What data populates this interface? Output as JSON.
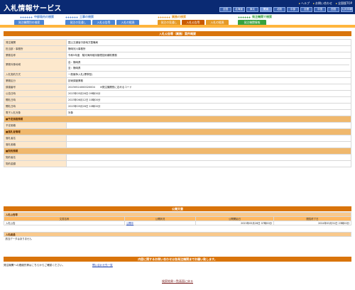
{
  "header": {
    "logo": "入札情報サービス",
    "toplinks": [
      "ヘルプ",
      "お問い合わせ",
      "全国版TOP"
    ],
    "regions": [
      "全国",
      "北海道",
      "東北",
      "関東",
      "北陸",
      "中部",
      "近畿",
      "中国",
      "四国",
      "九州沖縄"
    ],
    "active_region": "関東"
  },
  "nav": {
    "groups": [
      {
        "label": "中部局内の検索",
        "color": "#4d86d4"
      },
      {
        "label": "工事の検索",
        "color": "#4d86d4"
      },
      {
        "label": "業務の検索",
        "color": "#e59a26"
      },
      {
        "label": "発注機関で検索",
        "color": "#37a23f"
      }
    ],
    "tabs": [
      "発注機関別の検索",
      "発注の見通し",
      "入札公告等",
      "入札の経過",
      "発注の見通し",
      "入札公告等",
      "入札の経過",
      "発注機関情報"
    ]
  },
  "detail": {
    "title": "入札公告等（業務）案件概要",
    "rows": [
      {
        "label": "発注機関",
        "value": "国土交通省中部地方整備局"
      },
      {
        "label": "担当部・事務所",
        "value": "静岡河川事務所"
      },
      {
        "label": "業務名称",
        "value": "令和5年度　駿河海岸維持管理技術補助業務"
      },
      {
        "label": "業務対象地域",
        "value": "自：静岡県",
        "value2": "至：静岡県"
      },
      {
        "label": "入札契約方式",
        "value": "一般競争入札(標準型)"
      },
      {
        "label": "業務区分",
        "value": "技術調査業務"
      },
      {
        "label": "調達番号",
        "value": "20230524000020004　　※発注機関別に定めるコード"
      },
      {
        "label": "公告日時",
        "value": "2023年05月26日 09時00分"
      },
      {
        "label": "開札日時",
        "value": "2023年06月12日 10時00分"
      },
      {
        "label": "開札日時",
        "value": "2023年05月26日 10時00分"
      },
      {
        "label": "電子入札対象",
        "value": "対象"
      }
    ],
    "sections": [
      {
        "label": "■予定価格情報",
        "rows": [
          "予定価格"
        ]
      },
      {
        "label": "■落札者情報",
        "rows": [
          "落札者名",
          "落札価格"
        ]
      },
      {
        "label": "■契約情報",
        "rows": [
          "契約者名",
          "契約金額"
        ]
      }
    ]
  },
  "documents": {
    "title": "公開文書",
    "section1": "入札公告等",
    "headers": [
      "文書名称",
      "公開状況",
      "公開開始日",
      "閲覧終了日"
    ],
    "row": {
      "name": "入札公告",
      "status": "公開中",
      "start": "2023年05月26日 07時00分",
      "end": "2024年03月31日 23時00分"
    },
    "section2": "入札経過",
    "empty": "該当データはありません"
  },
  "contact": {
    "bar": "内容に関するお問い合わせは各発注機関までお願い致します。",
    "text": "発注機関への連絡先等はこちらからご確認ください。",
    "link": "問い合わせ先一覧"
  },
  "footer": {
    "back": "検索結果一覧画面に戻る"
  },
  "colors": {
    "header": "#0a2a73",
    "orange": "#d9740b",
    "label_bg": "#fde8cc",
    "section_bg": "#f0b86d"
  }
}
